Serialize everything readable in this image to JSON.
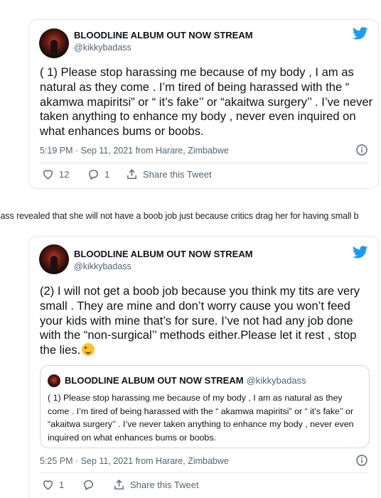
{
  "colors": {
    "twitter_blue": "#1d9bf0",
    "text": "#0f1419",
    "secondary": "#536471",
    "border": "#e1e8ed"
  },
  "tweet1": {
    "display_name": "BLOODLINE ALBUM OUT NOW STREAM",
    "handle": "@kikkybadass",
    "text": "( 1) Please stop harassing me because of my body , I am as natural as they come . I’m tired of being harassed with the “ akamwa mapiritsi” or “ it’s fake’’ or “akaitwa surgery’’ . I’ve never taken anything to enhance my body , never even inquired on what enhances bums or boobs.",
    "timestamp": "5:19 PM · Sep 11, 2021 from Harare, Zimbabwe",
    "like_count": "12",
    "reply_count": "1",
    "share_label": "Share this Tweet"
  },
  "caption": "badass revealed that she will not have a boob job just because critics drag her for having small b",
  "tweet2": {
    "display_name": "BLOODLINE ALBUM OUT NOW STREAM",
    "handle": "@kikkybadass",
    "text": "(2) I will not get a boob job because you think my tits are very small . They are mine and don’t worry cause you won’t feed your kids with mine that’s for sure. I’ve not had any job done with the “non-surgical’’ methods either.Please let it rest , stop the lies.",
    "emoji": "winking-face",
    "quoted": {
      "display_name": "BLOODLINE ALBUM OUT NOW STREAM",
      "handle": "@kikkybadass",
      "text": "( 1) Please stop harassing me because of my body , I am as natural as they come . I’m tired of being harassed with the “ akamwa mapiritsi” or “ it’s fake’’ or “akaitwa surgery’’ . I’ve never taken anything to enhance my body , never even inquired on what enhances bums or boobs."
    },
    "timestamp": "5:25 PM · Sep 11, 2021 from Harare, Zimbabwe",
    "like_count": "1",
    "share_label": "Share this Tweet"
  },
  "icons": [
    "twitter-bird-icon",
    "info-icon",
    "heart-icon",
    "reply-icon",
    "share-icon"
  ]
}
